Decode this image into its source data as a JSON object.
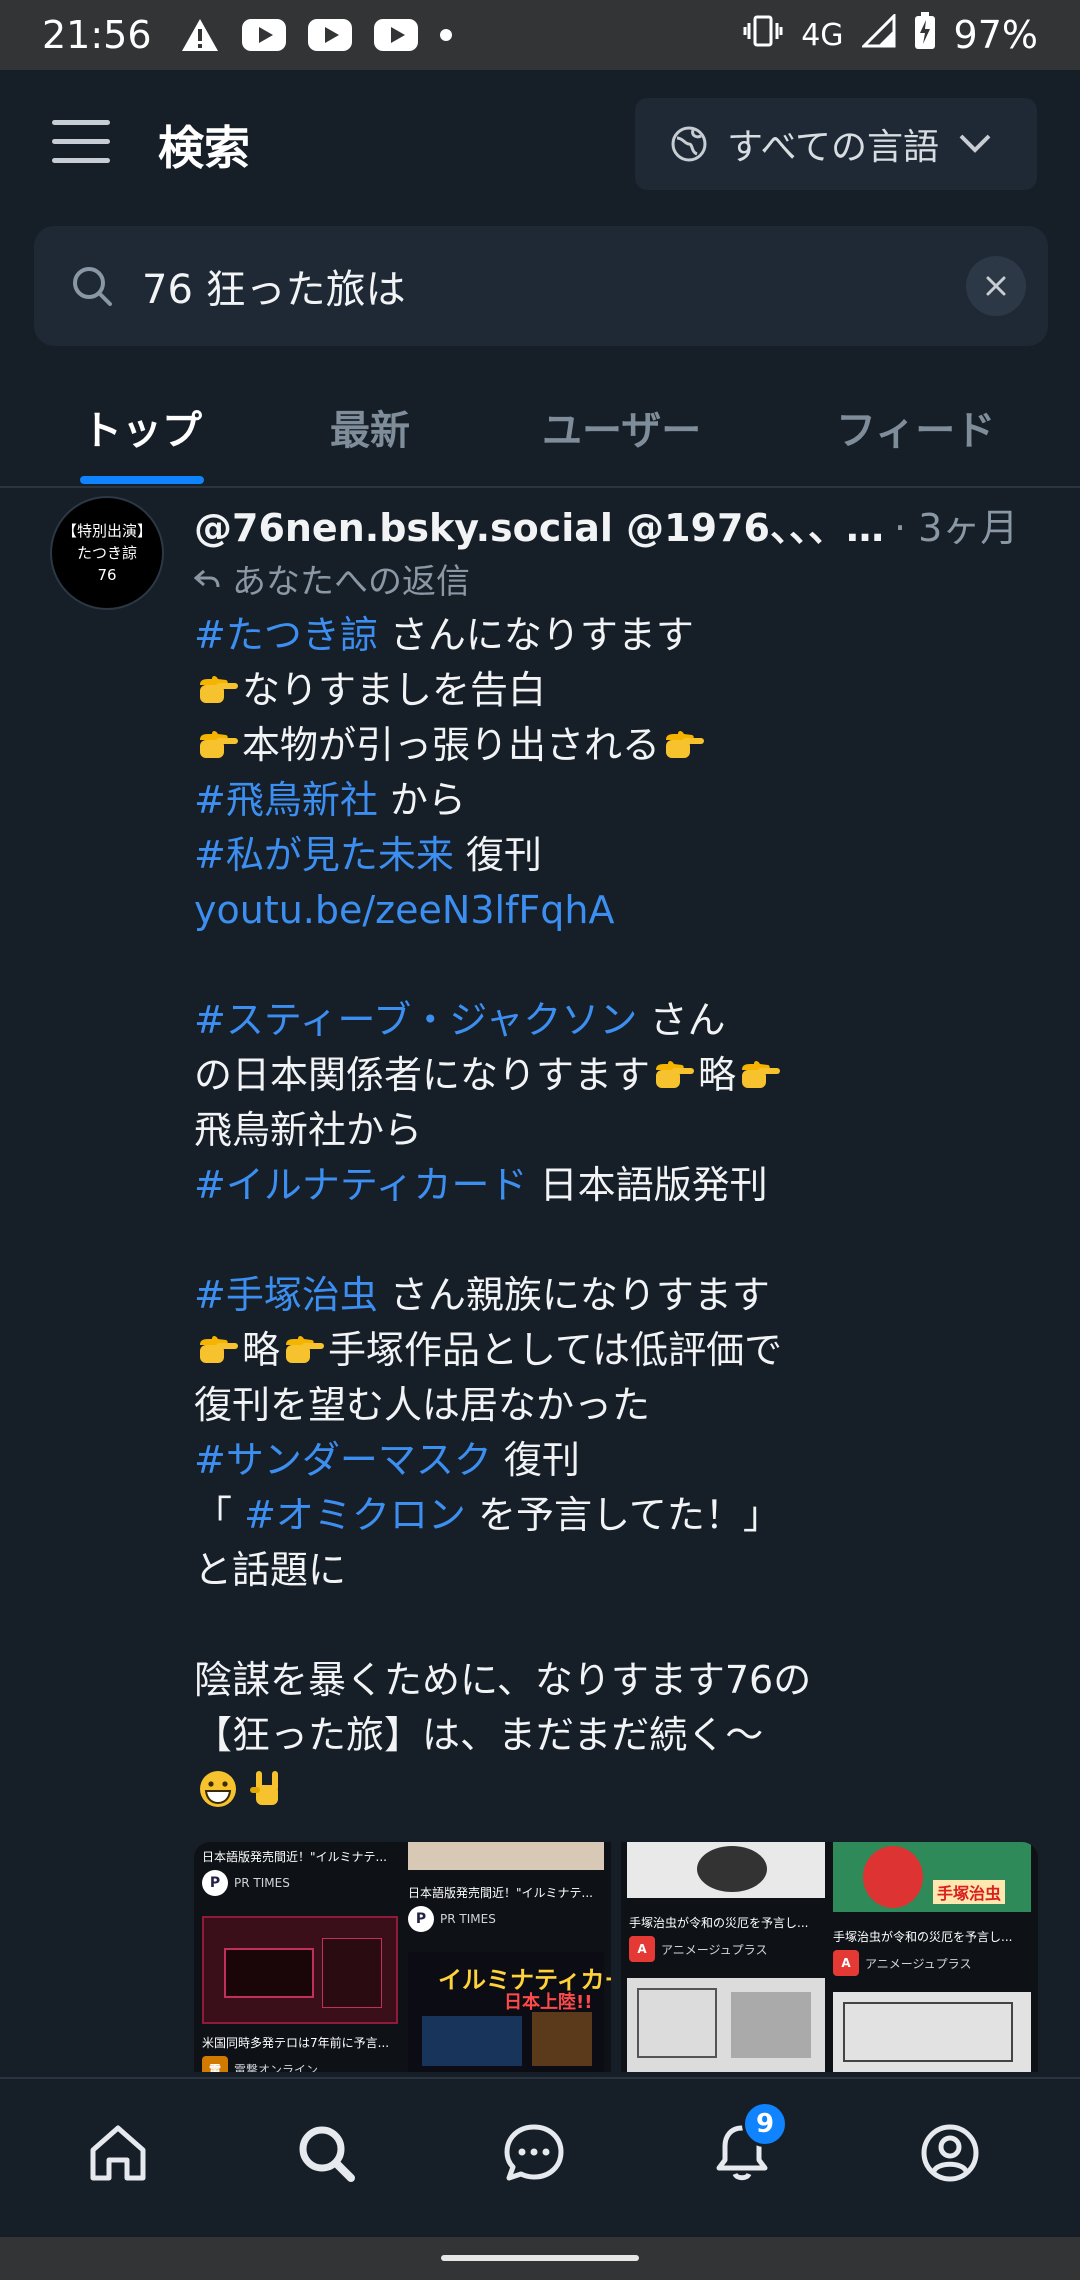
{
  "status_bar": {
    "time": "21:56",
    "network": "4G",
    "battery": "97%"
  },
  "header": {
    "title": "検索",
    "language_label": "すべての言語"
  },
  "search": {
    "value": "76 狂った旅は"
  },
  "tabs": [
    {
      "label": "トップ",
      "active": true
    },
    {
      "label": "最新",
      "active": false
    },
    {
      "label": "ユーザー",
      "active": false
    },
    {
      "label": "フィード",
      "active": false
    }
  ],
  "post": {
    "avatar_lines": [
      "【特別出演】",
      "たつき諒",
      "76"
    ],
    "handle": "@76nen.bsky.social @1976、、、…",
    "time": "· 3ヶ月",
    "reply_text": "あなたへの返信",
    "lines": [
      [
        {
          "t": "#たつき諒",
          "tag": true
        },
        {
          "t": " さんになりすます"
        }
      ],
      [
        {
          "t": "👉",
          "emoji": "point"
        },
        {
          "t": "なりすましを告白"
        }
      ],
      [
        {
          "t": "👉",
          "emoji": "point"
        },
        {
          "t": "本物が引っ張り出される"
        },
        {
          "t": "👉",
          "emoji": "point"
        }
      ],
      [
        {
          "t": "#飛鳥新社",
          "tag": true
        },
        {
          "t": " から"
        }
      ],
      [
        {
          "t": "#私が見た未来",
          "tag": true
        },
        {
          "t": " 復刊"
        }
      ],
      [
        {
          "t": "youtu.be/zeeN3lfFqhA",
          "tag": true
        }
      ],
      [],
      [
        {
          "t": "#スティーブ・ジャクソン",
          "tag": true
        },
        {
          "t": " さん"
        }
      ],
      [
        {
          "t": "の日本関係者になりすます"
        },
        {
          "t": "👉",
          "emoji": "point"
        },
        {
          "t": "略"
        },
        {
          "t": "👉",
          "emoji": "point"
        }
      ],
      [
        {
          "t": "飛鳥新社から"
        }
      ],
      [
        {
          "t": "#イルナティカード",
          "tag": true
        },
        {
          "t": " 日本語版発刊"
        }
      ],
      [],
      [
        {
          "t": "#手塚治虫",
          "tag": true
        },
        {
          "t": " さん親族になりすます"
        }
      ],
      [
        {
          "t": "👉",
          "emoji": "point"
        },
        {
          "t": "略"
        },
        {
          "t": "👉",
          "emoji": "point"
        },
        {
          "t": "手塚作品としては低評価で"
        }
      ],
      [
        {
          "t": "復刊を望む人は居なかった"
        }
      ],
      [
        {
          "t": "#サンダーマスク",
          "tag": true
        },
        {
          "t": " 復刊"
        }
      ],
      [
        {
          "t": "「 "
        },
        {
          "t": "#オミクロン",
          "tag": true
        },
        {
          "t": " を予言してた！」"
        }
      ],
      [
        {
          "t": "と話題に"
        }
      ],
      [],
      [
        {
          "t": "陰謀を暴くために、なりすます76の"
        }
      ],
      [
        {
          "t": "【狂った旅】は、まだまだ続く〜"
        }
      ],
      [
        {
          "t": "😀",
          "emoji": "grin"
        },
        {
          "t": "🤘",
          "emoji": "horns"
        }
      ]
    ],
    "images": {
      "left_card": {
        "title_a": "日本語版発売間近！\"イルミナテ...",
        "source_a": "PR TIMES",
        "title_b": "日本語版発売間近！\"イルミナテ...",
        "source_b": "PR TIMES",
        "title_c": "米国同時多発テロは7年前に予言...",
        "source_c": "電撃オンライン",
        "promo": "イルミナティカード",
        "promo_sub": "日本上陸!!"
      },
      "right_card": {
        "title_a": "手塚治虫が令和の災厄を予言し...",
        "source_a": "アニメージュプラス",
        "title_b": "手塚治虫が令和の災厄を予言し...",
        "source_b": "アニメージュプラス",
        "banner": "手塚治虫"
      }
    }
  },
  "bottom_nav": {
    "notification_count": "9"
  },
  "colors": {
    "accent": "#1083fe",
    "link": "#3c8ff0",
    "background": "#161e27"
  }
}
